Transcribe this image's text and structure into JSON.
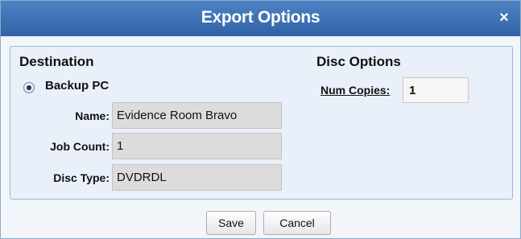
{
  "dialog": {
    "title": "Export Options",
    "close_glyph": "×"
  },
  "destination": {
    "title": "Destination",
    "option_label": "Backup PC",
    "option_selected": true,
    "fields": [
      {
        "label": "Name:",
        "value": "Evidence Room Bravo"
      },
      {
        "label": "Job Count:",
        "value": "1"
      },
      {
        "label": "Disc Type:",
        "value": "DVDRDL"
      }
    ]
  },
  "disc_options": {
    "title": "Disc Options",
    "num_copies_label": "Num Copies:",
    "num_copies_value": "1"
  },
  "buttons": {
    "save": "Save",
    "cancel": "Cancel"
  },
  "colors": {
    "titlebar": "#2f63a6",
    "panel": "#e9f0fa",
    "field_bg": "#dcdcdc"
  }
}
